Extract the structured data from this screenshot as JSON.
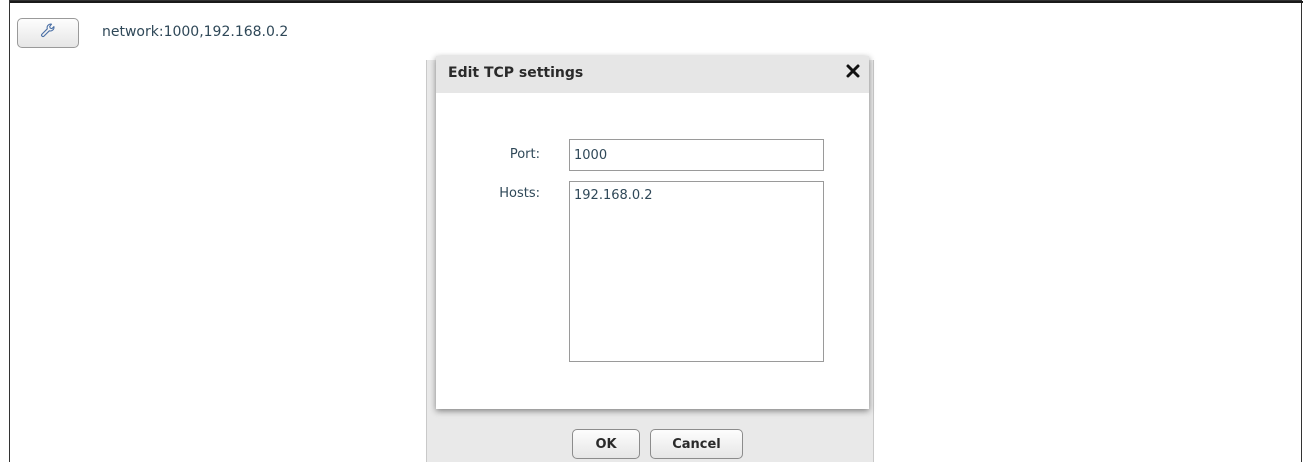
{
  "toolbar": {
    "settings_icon": "wrench-icon",
    "network_label": "network:1000,192.168.0.2"
  },
  "dialog": {
    "title": "Edit TCP settings",
    "close_icon": "close-icon",
    "port_label": "Port:",
    "port_value": "1000",
    "hosts_label": "Hosts:",
    "hosts_value": "192.168.0.2",
    "ok_label": "OK",
    "cancel_label": "Cancel"
  }
}
